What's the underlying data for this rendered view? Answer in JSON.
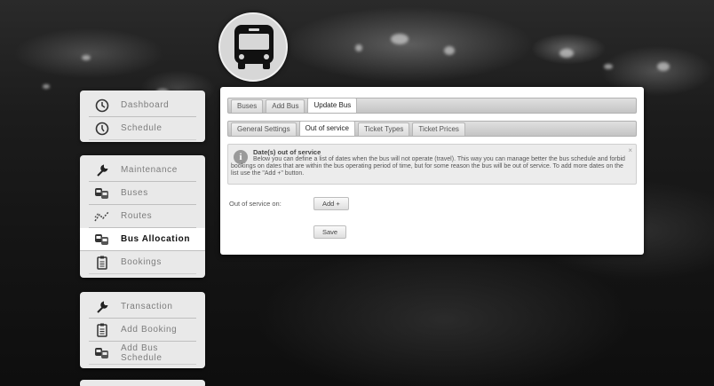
{
  "sidebar": {
    "groups": [
      {
        "items": [
          {
            "label": "Dashboard",
            "icon": "clock-icon"
          },
          {
            "label": "Schedule",
            "icon": "clock-icon"
          }
        ]
      },
      {
        "items": [
          {
            "label": "Maintenance",
            "icon": "wrench-icon"
          },
          {
            "label": "Buses",
            "icon": "buses-icon"
          },
          {
            "label": "Routes",
            "icon": "routes-icon"
          },
          {
            "label": "Bus Allocation",
            "icon": "buses-icon",
            "active": true
          },
          {
            "label": "Bookings",
            "icon": "document-icon"
          }
        ]
      },
      {
        "items": [
          {
            "label": "Transaction",
            "icon": "wrench-icon"
          },
          {
            "label": "Add Booking",
            "icon": "document-icon"
          },
          {
            "label": "Add Bus Schedule",
            "icon": "buses-icon"
          }
        ]
      }
    ]
  },
  "top_tabs": [
    {
      "label": "Buses"
    },
    {
      "label": "Add Bus"
    },
    {
      "label": "Update Bus",
      "active": true
    }
  ],
  "sub_tabs": [
    {
      "label": "General Settings"
    },
    {
      "label": "Out of service",
      "active": true
    },
    {
      "label": "Ticket Types"
    },
    {
      "label": "Ticket Prices"
    }
  ],
  "notice": {
    "title": "Date(s) out of service",
    "body": "Below you can define a list of dates when the bus will not operate (travel). This way you can manage better the bus schedule and forbid bookings on dates that are within the bus operating period of time, but for some reason the bus will be out of service. To add more dates on the list use the \"Add +\" button.",
    "close": "×"
  },
  "form": {
    "out_of_service_label": "Out of service on:",
    "add_button": "Add +",
    "save_button": "Save"
  }
}
